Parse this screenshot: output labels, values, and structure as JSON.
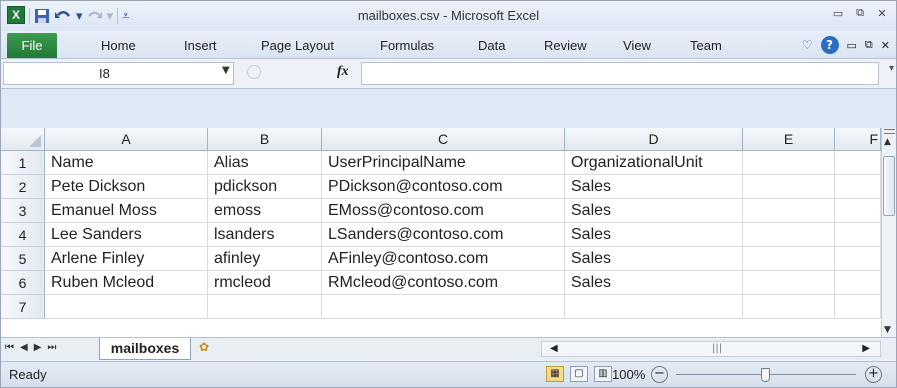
{
  "window": {
    "title": "mailboxes.csv - Microsoft Excel",
    "app_icon": "X",
    "qat": [
      "save-icon",
      "undo-icon",
      "redo-icon",
      "customize-icon"
    ]
  },
  "ribbon": {
    "file_label": "File",
    "tabs": [
      "Home",
      "Insert",
      "Page Layout",
      "Formulas",
      "Data",
      "Review",
      "View",
      "Team"
    ]
  },
  "formula_bar": {
    "name_box": "I8",
    "fx_label": "fx",
    "value": ""
  },
  "sheet": {
    "columns": [
      "A",
      "B",
      "C",
      "D",
      "E",
      "F"
    ],
    "rows": [
      {
        "num": "1",
        "cells": [
          "Name",
          "Alias",
          "UserPrincipalName",
          "OrganizationalUnit",
          "",
          ""
        ]
      },
      {
        "num": "2",
        "cells": [
          "Pete Dickson",
          "pdickson",
          "PDickson@contoso.com",
          "Sales",
          "",
          ""
        ]
      },
      {
        "num": "3",
        "cells": [
          "Emanuel Moss",
          "emoss",
          "EMoss@contoso.com",
          "Sales",
          "",
          ""
        ]
      },
      {
        "num": "4",
        "cells": [
          "Lee Sanders",
          "lsanders",
          "LSanders@contoso.com",
          "Sales",
          "",
          ""
        ]
      },
      {
        "num": "5",
        "cells": [
          "Arlene Finley",
          "afinley",
          "AFinley@contoso.com",
          "Sales",
          "",
          ""
        ]
      },
      {
        "num": "6",
        "cells": [
          "Ruben Mcleod",
          "rmcleod",
          "RMcleod@contoso.com",
          "Sales",
          "",
          ""
        ]
      },
      {
        "num": "7",
        "cells": [
          "",
          "",
          "",
          "",
          "",
          ""
        ]
      }
    ]
  },
  "sheet_tabs": {
    "active": "mailboxes"
  },
  "status_bar": {
    "status": "Ready",
    "zoom": "100%",
    "zoom_fraction": 0.5
  }
}
